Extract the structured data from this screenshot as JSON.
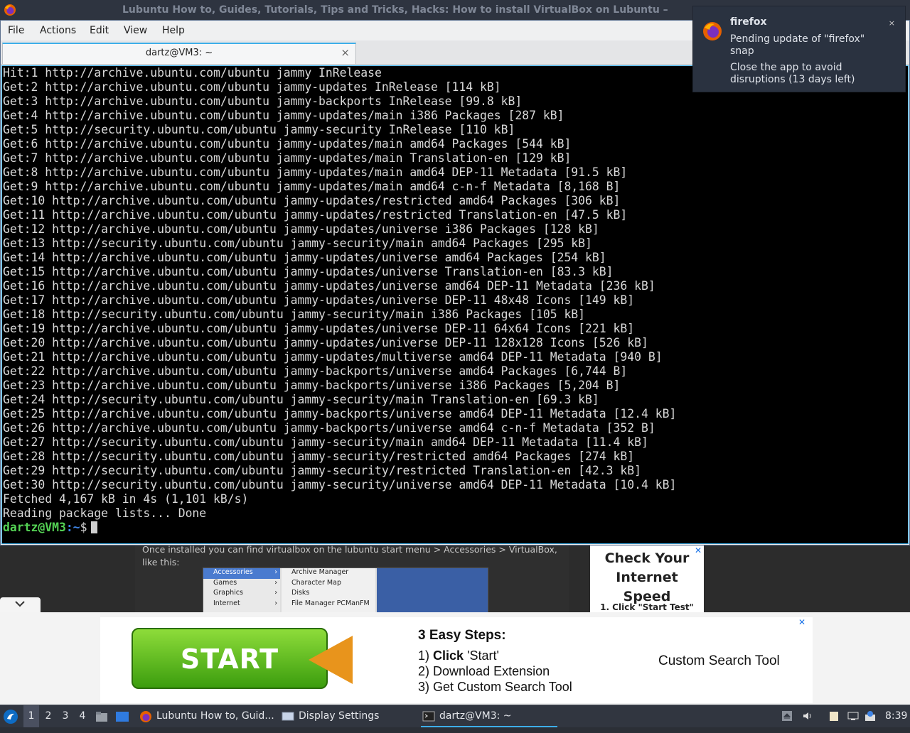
{
  "firefox_window": {
    "title": "Lubuntu How to, Guides, Tutorials, Tips and Tricks, Hacks: How to install VirtualBox on Lubuntu –"
  },
  "terminal": {
    "menu": [
      "File",
      "Actions",
      "Edit",
      "View",
      "Help"
    ],
    "tab_title": "dartz@VM3: ~",
    "tab_close": "×",
    "lines": [
      "Hit:1 http://archive.ubuntu.com/ubuntu jammy InRelease",
      "Get:2 http://archive.ubuntu.com/ubuntu jammy-updates InRelease [114 kB]",
      "Get:3 http://archive.ubuntu.com/ubuntu jammy-backports InRelease [99.8 kB]",
      "Get:4 http://archive.ubuntu.com/ubuntu jammy-updates/main i386 Packages [287 kB]",
      "Get:5 http://security.ubuntu.com/ubuntu jammy-security InRelease [110 kB]",
      "Get:6 http://archive.ubuntu.com/ubuntu jammy-updates/main amd64 Packages [544 kB]",
      "Get:7 http://archive.ubuntu.com/ubuntu jammy-updates/main Translation-en [129 kB]",
      "Get:8 http://archive.ubuntu.com/ubuntu jammy-updates/main amd64 DEP-11 Metadata [91.5 kB]",
      "Get:9 http://archive.ubuntu.com/ubuntu jammy-updates/main amd64 c-n-f Metadata [8,168 B]",
      "Get:10 http://archive.ubuntu.com/ubuntu jammy-updates/restricted amd64 Packages [306 kB]",
      "Get:11 http://archive.ubuntu.com/ubuntu jammy-updates/restricted Translation-en [47.5 kB]",
      "Get:12 http://archive.ubuntu.com/ubuntu jammy-updates/universe i386 Packages [128 kB]",
      "Get:13 http://security.ubuntu.com/ubuntu jammy-security/main amd64 Packages [295 kB]",
      "Get:14 http://archive.ubuntu.com/ubuntu jammy-updates/universe amd64 Packages [254 kB]",
      "Get:15 http://archive.ubuntu.com/ubuntu jammy-updates/universe Translation-en [83.3 kB]",
      "Get:16 http://archive.ubuntu.com/ubuntu jammy-updates/universe amd64 DEP-11 Metadata [236 kB]",
      "Get:17 http://archive.ubuntu.com/ubuntu jammy-updates/universe DEP-11 48x48 Icons [149 kB]",
      "Get:18 http://security.ubuntu.com/ubuntu jammy-security/main i386 Packages [105 kB]",
      "Get:19 http://archive.ubuntu.com/ubuntu jammy-updates/universe DEP-11 64x64 Icons [221 kB]",
      "Get:20 http://archive.ubuntu.com/ubuntu jammy-updates/universe DEP-11 128x128 Icons [526 kB]",
      "Get:21 http://archive.ubuntu.com/ubuntu jammy-updates/multiverse amd64 DEP-11 Metadata [940 B]",
      "Get:22 http://archive.ubuntu.com/ubuntu jammy-backports/universe amd64 Packages [6,744 B]",
      "Get:23 http://archive.ubuntu.com/ubuntu jammy-backports/universe i386 Packages [5,204 B]",
      "Get:24 http://security.ubuntu.com/ubuntu jammy-security/main Translation-en [69.3 kB]",
      "Get:25 http://archive.ubuntu.com/ubuntu jammy-backports/universe amd64 DEP-11 Metadata [12.4 kB]",
      "Get:26 http://archive.ubuntu.com/ubuntu jammy-backports/universe amd64 c-n-f Metadata [352 B]",
      "Get:27 http://security.ubuntu.com/ubuntu jammy-security/main amd64 DEP-11 Metadata [11.4 kB]",
      "Get:28 http://security.ubuntu.com/ubuntu jammy-security/restricted amd64 Packages [274 kB]",
      "Get:29 http://security.ubuntu.com/ubuntu jammy-security/restricted Translation-en [42.3 kB]",
      "Get:30 http://security.ubuntu.com/ubuntu jammy-security/universe amd64 DEP-11 Metadata [10.4 kB]",
      "Fetched 4,167 kB in 4s (1,101 kB/s)",
      "Reading package lists... Done"
    ],
    "prompt_user": "dartz@VM3",
    "prompt_path": ":~",
    "prompt_symbol": "$"
  },
  "webpage": {
    "text": "Once installed you can find virtualbox on the lubuntu start menu > Accessories > VirtualBox, like this:",
    "menu_screenshot": {
      "categories": [
        {
          "label": "Accessories",
          "selected": true
        },
        {
          "label": "Games",
          "selected": false
        },
        {
          "label": "Graphics",
          "selected": false
        },
        {
          "label": "Internet",
          "selected": false
        }
      ],
      "apps": [
        "Archive Manager",
        "Character Map",
        "Disks",
        "File Manager PCManFM"
      ]
    },
    "side_ad": {
      "headline": "Check Your Internet Speed",
      "step": "1. Click \"Start Test\"",
      "close": "✕"
    }
  },
  "banner_ad": {
    "button_label": "START",
    "heading": "3 Easy Steps:",
    "steps": [
      {
        "num": "1)",
        "bold": "Click",
        "text": " 'Start'"
      },
      {
        "num": "2)",
        "bold": "",
        "text": "Download Extension"
      },
      {
        "num": "3)",
        "bold": "",
        "text": "Get Custom Search Tool"
      }
    ],
    "product": "Custom Search Tool",
    "close": "✕"
  },
  "notification": {
    "app": "firefox",
    "line1": "Pending update of \"firefox\" snap",
    "line2": "Close the app to avoid disruptions (13 days left)",
    "close": "×"
  },
  "taskbar": {
    "workspaces": [
      "1",
      "2",
      "3",
      "4"
    ],
    "active_workspace": "1",
    "tasks": [
      {
        "label": "Lubuntu How to, Guid...",
        "icon": "firefox-icon",
        "active": false
      },
      {
        "label": "Display Settings",
        "icon": "display-settings-icon",
        "active": false
      },
      {
        "label": "dartz@VM3: ~",
        "icon": "terminal-icon",
        "active": true
      }
    ],
    "clock": "8:39"
  },
  "colors": {
    "terminal_bg": "#000000",
    "prompt_green": "#54d254",
    "prompt_blue": "#3f84e5",
    "accent": "#3daee9",
    "taskbar": "#313640"
  }
}
